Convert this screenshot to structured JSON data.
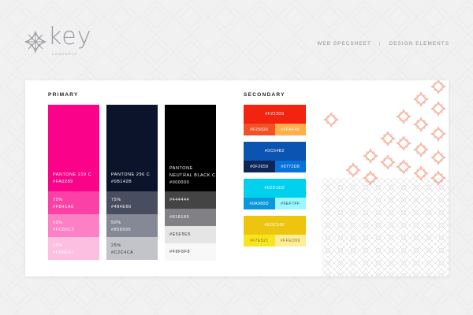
{
  "header": {
    "logo_word": "key",
    "logo_sub": "CONCEPTS",
    "nav_left": "WEB SPECSHEET",
    "nav_sep": "|",
    "nav_right": "DESIGN ELEMENTS"
  },
  "primary": {
    "title": "PRIMARY",
    "columns": [
      {
        "name": "PANTONE 219 C",
        "hex": "#FA0289",
        "tints": [
          {
            "label": "75%",
            "hex": "#FB41A6"
          },
          {
            "label": "50%",
            "hex": "#FC80C3"
          },
          {
            "label": "25%",
            "hex": "#FDBFE1"
          }
        ]
      },
      {
        "name": "PANTONE 296 C",
        "hex": "#0B142B",
        "tints": [
          {
            "label": "75%",
            "hex": "#484E60"
          },
          {
            "label": "50%",
            "hex": "#858995"
          },
          {
            "label": "25%",
            "hex": "#C2C4CA"
          }
        ]
      },
      {
        "name_line1": "PANTONE",
        "name_line2": "NEUTRAL BLACK C",
        "hex": "#000000",
        "tints": [
          {
            "hex": "#444444"
          },
          {
            "hex": "#818185"
          },
          {
            "hex": "#E5E5E5"
          },
          {
            "hex": "#F8F8F8"
          }
        ]
      }
    ]
  },
  "secondary": {
    "title": "SECONDARY",
    "blocks": [
      {
        "main": "#F2230S",
        "left": "#F25026",
        "right": "#FFAF48"
      },
      {
        "main": "#0C54B2",
        "left": "#0F2659",
        "right": "#0772D8"
      },
      {
        "main": "#02D1ED",
        "left": "#0A980D",
        "right": "#9EF7FF"
      },
      {
        "main": "#EDC50F",
        "left": "#F7E521",
        "right": "#FFED99"
      }
    ]
  },
  "colors": {
    "page_bg": "#f1f1f2",
    "pattern_orange": "#f2a48a",
    "pattern_gray": "#c4c4c8"
  }
}
